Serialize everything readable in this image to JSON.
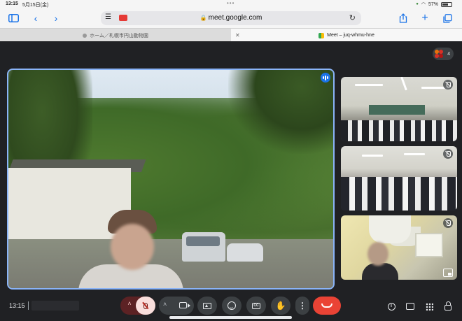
{
  "status_bar": {
    "time": "13:15",
    "date": "5月15日(金)",
    "battery": "57%",
    "battery_level": 0.57
  },
  "browser": {
    "url": "meet.google.com",
    "tabs": [
      {
        "label": "ホーム／札幌市円山動物園",
        "active": false
      },
      {
        "label": "Meet – juq-whmu-hne",
        "active": true
      }
    ]
  },
  "meet": {
    "participant_count": "4",
    "clock": "13:15",
    "colors": {
      "background": "#202124",
      "leave": "#ea4335",
      "mic_off": "#f9dedc",
      "speaking_border": "#8ab4f8"
    }
  }
}
